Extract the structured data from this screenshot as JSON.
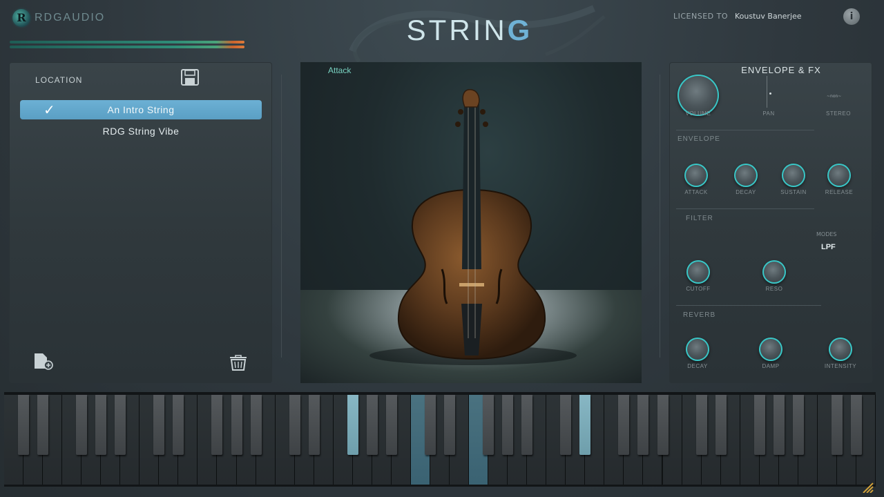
{
  "header": {
    "logo_text": "RDGAUDIO",
    "logo_mark": "R",
    "title_main": "STRIN",
    "title_accent": "G",
    "license_label": "LICENSED TO",
    "license_name": "Koustuv Banerjee",
    "info_glyph": "i"
  },
  "icons": {
    "logo": "rdgaudio-logo-icon",
    "save": "floppy-save-icon",
    "check": "checkmark-icon",
    "new_preset": "new-document-icon",
    "trash": "trash-icon",
    "info": "info-icon",
    "resize": "resize-grip-icon"
  },
  "presets": {
    "label": "LOCATION",
    "items": [
      {
        "label": "An Intro String",
        "selected": true
      },
      {
        "label": "RDG String Vibe",
        "selected": false
      }
    ]
  },
  "center": {
    "label": "Attack"
  },
  "fx": {
    "title": "ENVELOPE & FX",
    "top_knobs": {
      "volume": "VOLUME",
      "pan": "PAN",
      "stereo": "STEREO",
      "stereo_value": "~non~"
    },
    "envelope": {
      "title": "ENVELOPE",
      "attack": "ATTACK",
      "decay": "DECAY",
      "sustain": "SUSTAIN",
      "release": "RELEASE"
    },
    "filter": {
      "title": "FILTER",
      "cutoff": "CUTOFF",
      "reso": "RESO",
      "modes_label": "MODES",
      "modes_value": "LPF"
    },
    "reverb": {
      "title": "REVERB",
      "decay": "DECAY",
      "damp": "DAMP",
      "intensity": "INTENSITY"
    }
  },
  "keyboard": {
    "white_keys": 45,
    "pressed_white": [
      21,
      24
    ],
    "pressed_black": [
      12,
      21
    ]
  },
  "colors": {
    "accent": "#6cb0d4",
    "knob_ring": "#38c7c7",
    "attack_label": "#7ad3c2",
    "pressed_key": "#4a7280"
  }
}
